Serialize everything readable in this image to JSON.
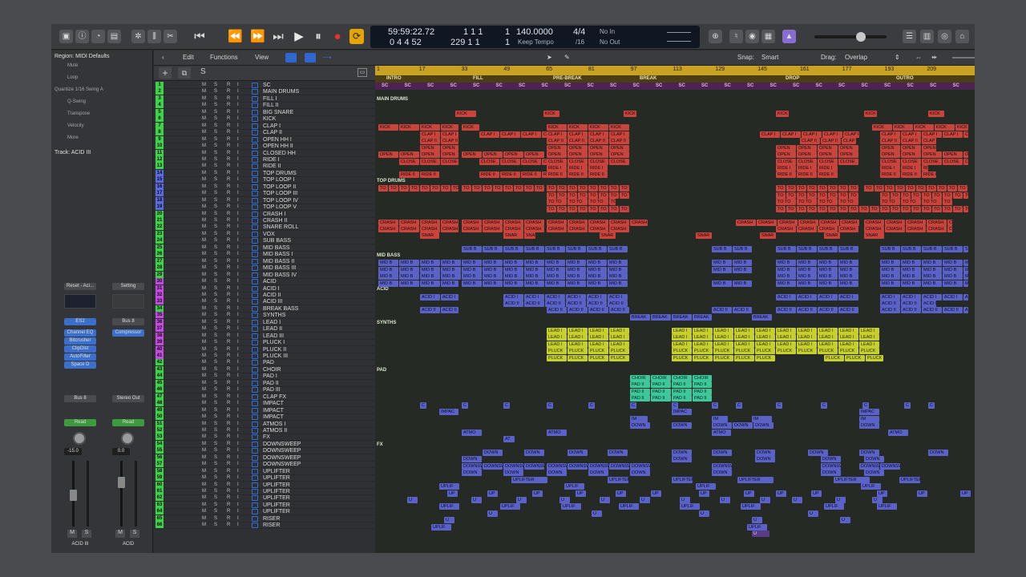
{
  "toolbar": {
    "counter": {
      "time": "59:59:22.72",
      "bars": "0  4  4    52",
      "sub_top": "1    1    1",
      "sub_bot": "229   1   1",
      "beat_top": "1",
      "beat_bot": "1",
      "tempo": "140.0000",
      "tempo_mode": "Keep Tempo",
      "sig": "4/4",
      "div": "/16",
      "in": "No In",
      "out": "No Out"
    },
    "accent": "#e3a600"
  },
  "header": {
    "edit": "Edit",
    "functions": "Functions",
    "view": "View",
    "snap_label": "Snap:",
    "snap_value": "Smart",
    "drag_label": "Drag:",
    "drag_value": "Overlap"
  },
  "inspector": {
    "region": "Region: MIDI Defaults",
    "rows": [
      "Mute",
      "Loop",
      "Quantize    1/16 Swing A",
      "Q-Swing",
      "Transpose",
      "Velocity",
      "More"
    ],
    "track": "Track: ACID III",
    "strip1": {
      "setting": "Reset - Aci...",
      "instrument": "ES2",
      "fx": [
        "Channel EQ",
        "Bitcrusher",
        "ClipDist",
        "AutoFilter",
        "Space D"
      ],
      "send": "Bus 8",
      "auto": "Read",
      "vol": "-15.0",
      "name": "ACID III"
    },
    "strip2": {
      "setting": "Setting",
      "io": "Bus 8",
      "fx": [
        "Compressor"
      ],
      "send": "Stereo Out",
      "auto": "Read",
      "vol": "0.0",
      "name": "ACID"
    },
    "ms": [
      "M",
      "S"
    ]
  },
  "markers": [
    "INTRO",
    "FILL",
    "PRE-BREAK",
    "BREAK",
    "DROP",
    "OUTRO"
  ],
  "ruler": [
    "1",
    "17",
    "33",
    "49",
    "65",
    "81",
    "97",
    "113",
    "129",
    "145",
    "161",
    "177",
    "193",
    "209"
  ],
  "tracks": [
    {
      "n": "1",
      "name": "SC",
      "c": "#3fd14a"
    },
    {
      "n": "2",
      "name": "MAIN DRUMS",
      "c": "#3fd14a"
    },
    {
      "n": "3",
      "name": "FILL I",
      "c": "#3fd14a"
    },
    {
      "n": "4",
      "name": "FILL II",
      "c": "#3fd14a"
    },
    {
      "n": "5",
      "name": "BIG SNARE",
      "c": "#3fd14a"
    },
    {
      "n": "6",
      "name": "KICK",
      "c": "#3fd14a"
    },
    {
      "n": "7",
      "name": "CLAP I",
      "c": "#3fd14a"
    },
    {
      "n": "8",
      "name": "CLAP II",
      "c": "#3fd14a"
    },
    {
      "n": "9",
      "name": "OPEN HH I",
      "c": "#3fd14a"
    },
    {
      "n": "10",
      "name": "OPEN HH II",
      "c": "#3fd14a"
    },
    {
      "n": "11",
      "name": "CLOSED HH",
      "c": "#3fd14a"
    },
    {
      "n": "12",
      "name": "RIDE I",
      "c": "#3fd14a"
    },
    {
      "n": "13",
      "name": "RIDE II",
      "c": "#3fd14a"
    },
    {
      "n": "14",
      "name": "TOP DRUMS",
      "c": "#5a6be0"
    },
    {
      "n": "15",
      "name": "TOP LOOP I",
      "c": "#5a6be0"
    },
    {
      "n": "16",
      "name": "TOP LOOP II",
      "c": "#5a6be0"
    },
    {
      "n": "17",
      "name": "TOP LOOP III",
      "c": "#5a6be0"
    },
    {
      "n": "18",
      "name": "TOP LOOP IV",
      "c": "#5a6be0"
    },
    {
      "n": "19",
      "name": "TOP LOOP V",
      "c": "#5a6be0"
    },
    {
      "n": "20",
      "name": "CRASH I",
      "c": "#3fd14a"
    },
    {
      "n": "21",
      "name": "CRASH II",
      "c": "#3fd14a"
    },
    {
      "n": "22",
      "name": "SNARE ROLL",
      "c": "#3fd14a"
    },
    {
      "n": "23",
      "name": "VOX",
      "c": "#3fd14a"
    },
    {
      "n": "24",
      "name": "SUB BASS",
      "c": "#3fd14a"
    },
    {
      "n": "25",
      "name": "MID BASS",
      "c": "#3fd14a"
    },
    {
      "n": "26",
      "name": "MID BASS I",
      "c": "#3fd14a"
    },
    {
      "n": "27",
      "name": "MID BASS II",
      "c": "#3fd14a"
    },
    {
      "n": "28",
      "name": "MID BASS III",
      "c": "#3fd14a"
    },
    {
      "n": "29",
      "name": "MID BASS IV",
      "c": "#3fd14a"
    },
    {
      "n": "30",
      "name": "ACID",
      "c": "#c44be0"
    },
    {
      "n": "31",
      "name": "ACID I",
      "c": "#c44be0"
    },
    {
      "n": "32",
      "name": "ACID II",
      "c": "#c44be0"
    },
    {
      "n": "33",
      "name": "ACID III",
      "c": "#c44be0"
    },
    {
      "n": "34",
      "name": "BREAK BASS",
      "c": "#3fd14a"
    },
    {
      "n": "35",
      "name": "SYNTHS",
      "c": "#c44be0"
    },
    {
      "n": "36",
      "name": "LEAD I",
      "c": "#c44be0"
    },
    {
      "n": "37",
      "name": "LEAD II",
      "c": "#c44be0"
    },
    {
      "n": "38",
      "name": "LEAD III",
      "c": "#c44be0"
    },
    {
      "n": "39",
      "name": "PLUCK I",
      "c": "#c44be0"
    },
    {
      "n": "40",
      "name": "PLUCK II",
      "c": "#c44be0"
    },
    {
      "n": "41",
      "name": "PLUCK III",
      "c": "#c44be0"
    },
    {
      "n": "42",
      "name": "PAD",
      "c": "#3fd14a"
    },
    {
      "n": "43",
      "name": "CHOIR",
      "c": "#3fd14a"
    },
    {
      "n": "44",
      "name": "PAD I",
      "c": "#3fd14a"
    },
    {
      "n": "45",
      "name": "PAD II",
      "c": "#3fd14a"
    },
    {
      "n": "46",
      "name": "PAD III",
      "c": "#3fd14a"
    },
    {
      "n": "47",
      "name": "CLAP FX",
      "c": "#3fd14a"
    },
    {
      "n": "48",
      "name": "IMPACT",
      "c": "#3fd14a"
    },
    {
      "n": "49",
      "name": "IMPACT",
      "c": "#3fd14a"
    },
    {
      "n": "50",
      "name": "IMPACT",
      "c": "#3fd14a"
    },
    {
      "n": "51",
      "name": "ATMOS I",
      "c": "#3fd14a"
    },
    {
      "n": "52",
      "name": "ATMOS II",
      "c": "#3fd14a"
    },
    {
      "n": "53",
      "name": "FX",
      "c": "#3fd14a"
    },
    {
      "n": "54",
      "name": "DOWNSWEEP",
      "c": "#3fd14a"
    },
    {
      "n": "55",
      "name": "DOWNSWEEP",
      "c": "#3fd14a"
    },
    {
      "n": "56",
      "name": "DOWNSWEEP",
      "c": "#3fd14a"
    },
    {
      "n": "57",
      "name": "DOWNSWEEP",
      "c": "#3fd14a"
    },
    {
      "n": "58",
      "name": "UPLIFTER",
      "c": "#3fd14a"
    },
    {
      "n": "59",
      "name": "UPLIFTER",
      "c": "#3fd14a"
    },
    {
      "n": "60",
      "name": "UPLIFTER",
      "c": "#3fd14a"
    },
    {
      "n": "61",
      "name": "UPLIFTER",
      "c": "#3fd14a"
    },
    {
      "n": "62",
      "name": "UPLIFTER",
      "c": "#3fd14a"
    },
    {
      "n": "63",
      "name": "UPLIFTER",
      "c": "#3fd14a"
    },
    {
      "n": "64",
      "name": "UPLIFTER",
      "c": "#3fd14a"
    },
    {
      "n": "65",
      "name": "RISER",
      "c": "#3fd14a"
    },
    {
      "n": "66",
      "name": "RISER",
      "c": "#3fd14a"
    }
  ],
  "folders": [
    {
      "row": 1,
      "label": "MAIN DRUMS"
    },
    {
      "row": 13,
      "label": "TOP DRUMS"
    },
    {
      "row": 24,
      "label": "MID BASS"
    },
    {
      "row": 29,
      "label": "ACID"
    },
    {
      "row": 34,
      "label": "SYNTHS"
    },
    {
      "row": 41,
      "label": "PAD"
    },
    {
      "row": 52,
      "label": "FX"
    }
  ],
  "region_labels": {
    "kick": "KICK",
    "clap": "CLAP I",
    "clap2": "CLAP II",
    "open": "OPEN",
    "close": "CLOSE",
    "ride": "RIDE I",
    "ride2": "RIDE II",
    "top": "TO TO",
    "crash": "CRASH",
    "snare": "SNAR",
    "sub": "SUB B",
    "mid": "MID B",
    "acid": "ACID I",
    "acid2": "ACID II",
    "brk": "BREAK",
    "lead": "LEAD I",
    "pluck": "PLUCK",
    "choir": "CHOIR",
    "pad": "PAD II",
    "c": "C",
    "impact": "IMPAC",
    "im": "IM",
    "down": "DOWN",
    "atmo": "ATMO",
    "downsw": "DOWNSW",
    "uplif": "UPLIF",
    "up": "UP",
    "uplifter": "UPLIFTER",
    "u": "U",
    "sc": "SC",
    "at": "AT"
  }
}
